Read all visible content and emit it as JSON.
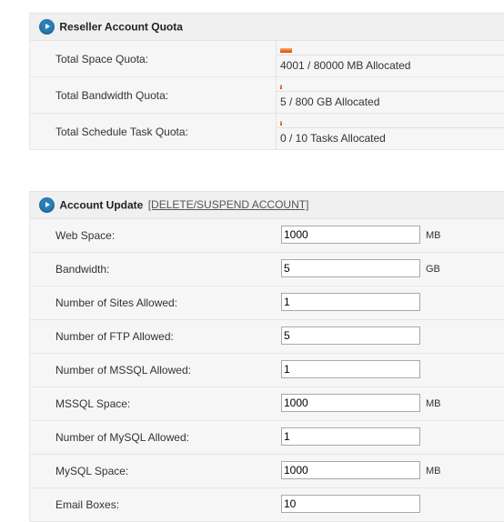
{
  "quota": {
    "title": "Reseller Account Quota",
    "rows": [
      {
        "label": "Total Space Quota:",
        "text": "4001 / 80000 MB Allocated",
        "fill": 0.05
      },
      {
        "label": "Total Bandwidth Quota:",
        "text": "5 / 800 GB Allocated",
        "fill": 0.006
      },
      {
        "label": "Total Schedule Task Quota:",
        "text": "0 / 10 Tasks Allocated",
        "fill": 0
      }
    ]
  },
  "update": {
    "title": "Account Update",
    "delete_link": "[DELETE/SUSPEND ACCOUNT]",
    "rows": [
      {
        "label": "Web Space:",
        "value": "1000",
        "unit": "MB"
      },
      {
        "label": "Bandwidth:",
        "value": "5",
        "unit": "GB"
      },
      {
        "label": "Number of Sites Allowed:",
        "value": "1",
        "unit": ""
      },
      {
        "label": "Number of FTP Allowed:",
        "value": "5",
        "unit": ""
      },
      {
        "label": "Number of MSSQL Allowed:",
        "value": "1",
        "unit": ""
      },
      {
        "label": "MSSQL Space:",
        "value": "1000",
        "unit": "MB"
      },
      {
        "label": "Number of MySQL Allowed:",
        "value": "1",
        "unit": ""
      },
      {
        "label": "MySQL Space:",
        "value": "1000",
        "unit": "MB"
      },
      {
        "label": "Email Boxes:",
        "value": "10",
        "unit": ""
      }
    ]
  }
}
